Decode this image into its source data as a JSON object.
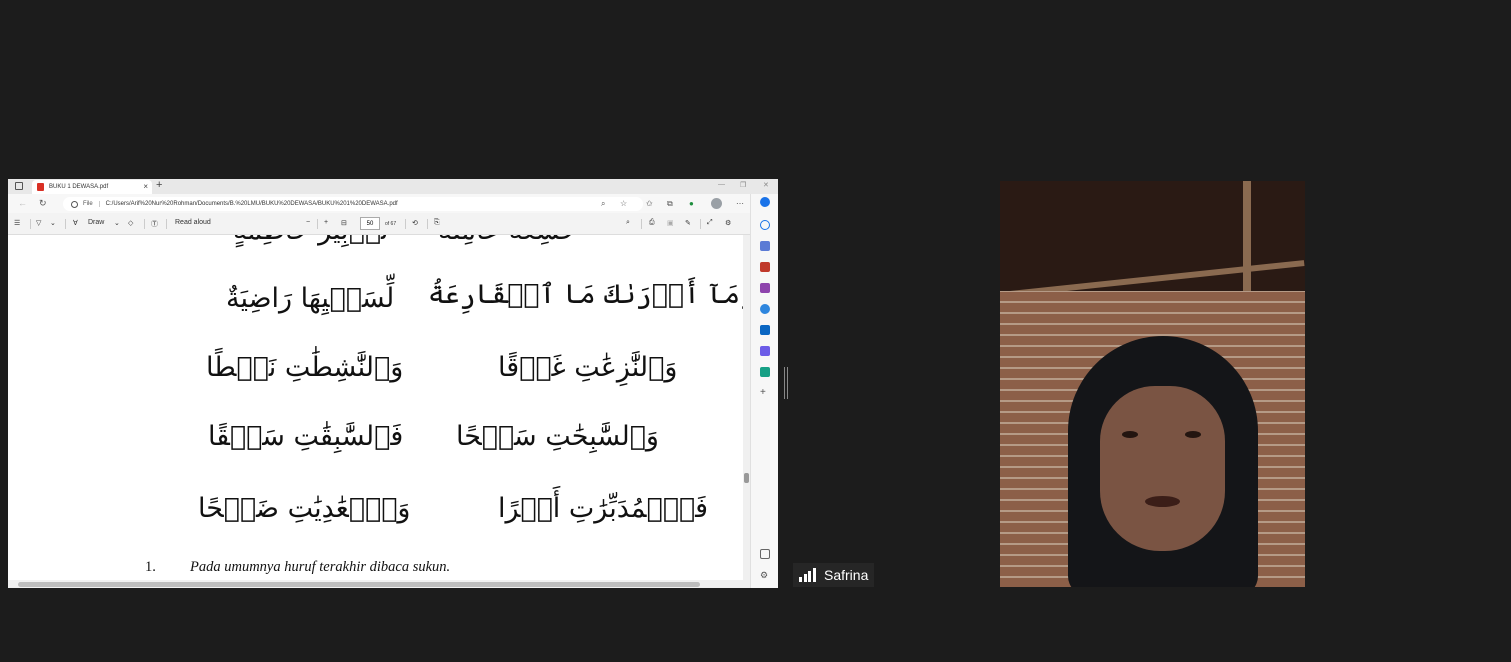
{
  "browser": {
    "tab": {
      "title": "BUKU 1 DEWASA.pdf"
    },
    "address": {
      "scheme": "File",
      "url": "C:/Users/Arif%20Nur%20Rohman/Documents/B.%20LMU/BUKU%20DEWASA/BUKU%201%20DEWASA.pdf"
    },
    "toolbar": {
      "draw_label": "Draw",
      "read_aloud_label": "Read aloud",
      "page_current": "50",
      "page_total": "of 67"
    }
  },
  "pdf": {
    "lines": [
      {
        "right": "وَمَآ أَدۡرَىٰكَ مَا ٱلۡقَارِعَةُ",
        "left": "لِّسَعۡيِهَا رَاضِيَةٌ"
      },
      {
        "right": "وَٱلنَّٰزِعَٰتِ غَرۡقًا",
        "left": "وَٱلنَّٰشِطَٰتِ نَشۡطًا"
      },
      {
        "right": "وَٱلسَّٰبِحَٰتِ سَبۡحًا",
        "left": "فَٱلسَّٰبِقَٰتِ سَبۡقًا"
      },
      {
        "right": "فَٱلۡمُدَبِّرَٰتِ أَمۡرًا",
        "left": "وَٱلۡعَٰدِيَٰتِ ضَبۡحًا"
      }
    ],
    "partial_top_right": "خَٰشِعَةٌ عَامِلَةٌ",
    "partial_top_left": "تَدۡبِيرُ حَاطِمَةٍ",
    "note_number": "1.",
    "note_text": "Pada umumnya huruf terakhir dibaca sukun."
  },
  "meeting": {
    "participant_name": "Safrina"
  },
  "colors": {
    "accent": "#1a73e8",
    "pdf_icon": "#d93025",
    "background": "#1c1c1c"
  }
}
